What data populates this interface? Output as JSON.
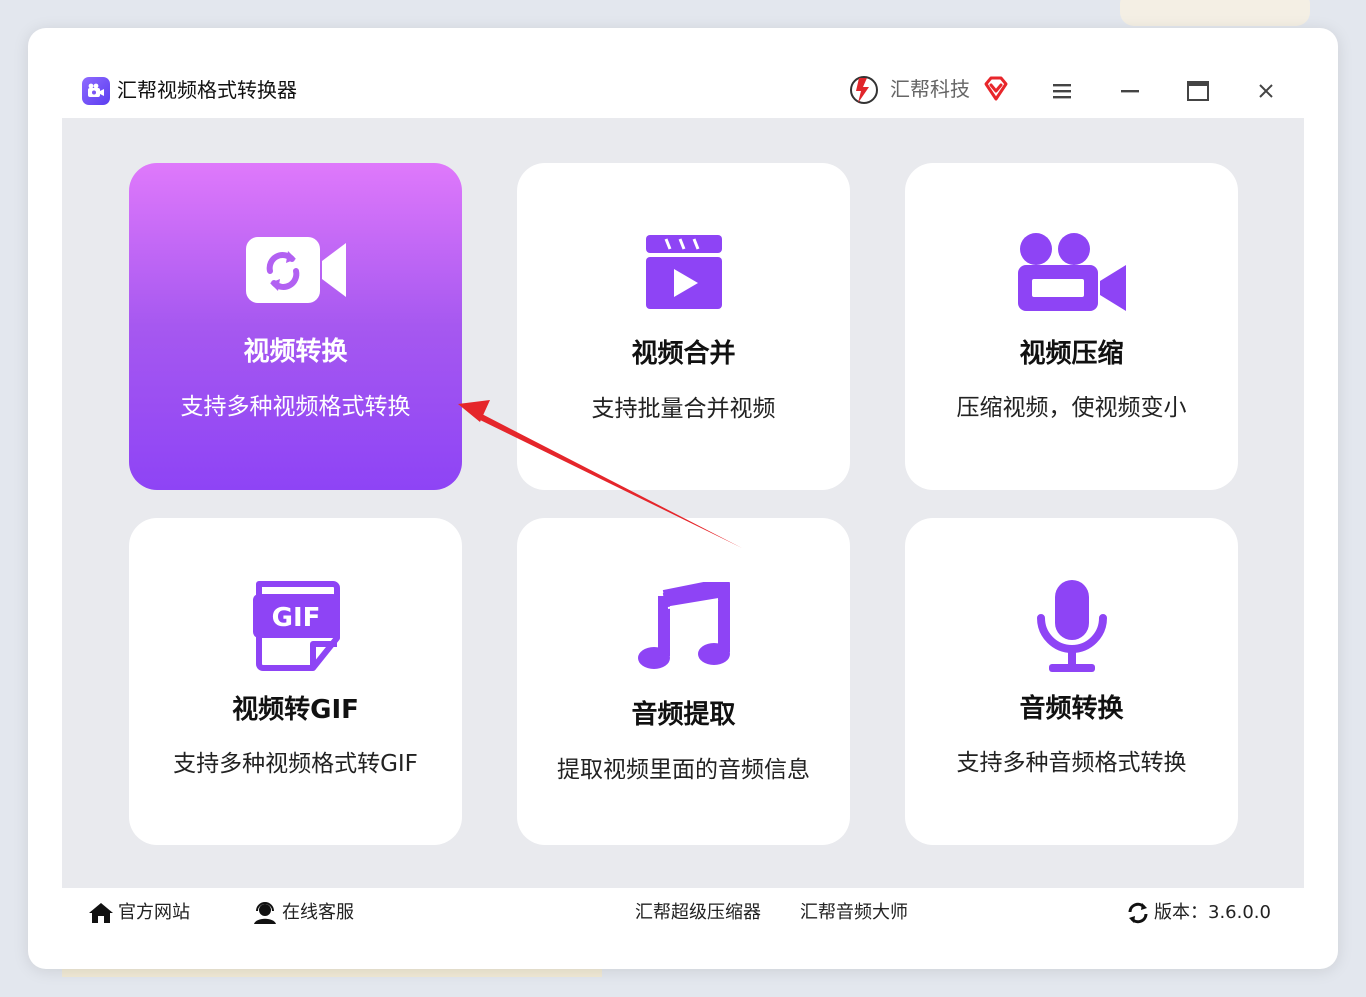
{
  "window": {
    "app_title": "汇帮视频格式转换器",
    "brand_name": "汇帮科技",
    "accent": "#8e44f5"
  },
  "cards": [
    {
      "title": "视频转换",
      "subtitle": "支持多种视频格式转换",
      "icon": "video-convert-icon",
      "active": true
    },
    {
      "title": "视频合并",
      "subtitle": "支持批量合并视频",
      "icon": "clapperboard-play-icon",
      "active": false
    },
    {
      "title": "视频压缩",
      "subtitle": "压缩视频，使视频变小",
      "icon": "movie-camera-icon",
      "active": false
    },
    {
      "title": "视频转GIF",
      "subtitle": "支持多种视频格式转GIF",
      "icon": "gif-file-icon",
      "active": false
    },
    {
      "title": "音频提取",
      "subtitle": "提取视频里面的音频信息",
      "icon": "music-note-icon",
      "active": false
    },
    {
      "title": "音频转换",
      "subtitle": "支持多种音频格式转换",
      "icon": "microphone-icon",
      "active": false
    }
  ],
  "footer": {
    "official_site": "官方网站",
    "online_service": "在线客服",
    "link_compressor": "汇帮超级压缩器",
    "link_audio_master": "汇帮音频大师",
    "version": "版本：3.6.0.0"
  }
}
